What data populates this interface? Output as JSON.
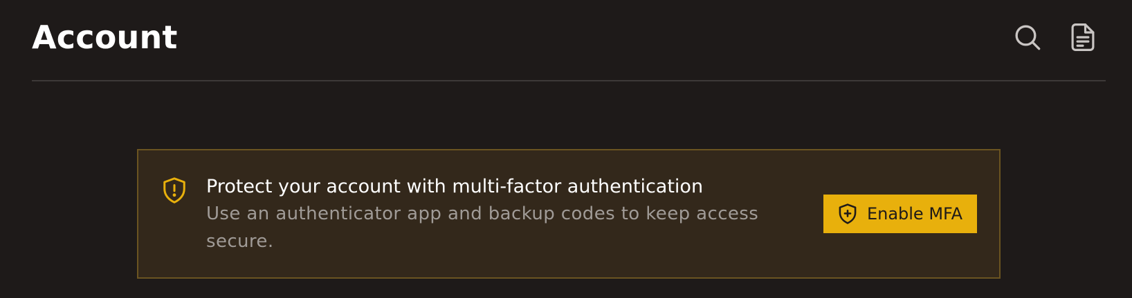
{
  "header": {
    "title": "Account",
    "actions": [
      {
        "icon": "search-icon"
      },
      {
        "icon": "document-icon"
      }
    ]
  },
  "alert": {
    "icon": "shield-alert-icon",
    "title": "Protect your account with multi-factor authentication",
    "description": "Use an authenticator app and backup codes to keep access secure.",
    "button": {
      "icon": "shield-plus-icon",
      "label": "Enable MFA"
    }
  },
  "colors": {
    "background": "#1e1a19",
    "alert_background": "#33281b",
    "alert_border": "#6b5421",
    "accent": "#e8b00c",
    "muted_text": "#a09b97",
    "divider": "#3d3938"
  }
}
